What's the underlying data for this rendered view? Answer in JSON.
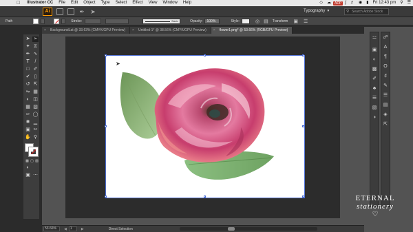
{
  "menubar": {
    "apple": "",
    "app_name": "Illustrator CC",
    "items": [
      "File",
      "Edit",
      "Object",
      "Type",
      "Select",
      "Effect",
      "View",
      "Window",
      "Help"
    ],
    "status_badge": "ADP",
    "clock": "Fri 12:43 pm"
  },
  "appbar": {
    "logo": "Ai",
    "workspace": "Typography",
    "search_placeholder": "Search Adobe Stock"
  },
  "controlbar": {
    "path_label": "Path",
    "stroke_label": "Stroke:",
    "stroke_profile": "Basic",
    "opacity_label": "Opacity:",
    "opacity_value": "100%",
    "style_label": "Style:",
    "transform_label": "Transform"
  },
  "tabs": [
    {
      "label": "BackgroundLat @ 33.63% (CMYK/GPU Preview)",
      "active": false
    },
    {
      "label": "Untitled-1* @ 38.56% (CMYK/GPU Preview)",
      "active": false
    },
    {
      "label": "flower1.png* @ 53.66% (RGB/GPU Preview)",
      "active": true
    }
  ],
  "statusbar": {
    "zoom": "53.66%",
    "page": "1",
    "tool_name": "Direct Selection"
  },
  "watermark": {
    "line1": "ETERNAL",
    "line2": "stationery",
    "heart": "♡"
  },
  "colors": {
    "artboard_outline": "#4d6fd4",
    "logo_accent": "#ff9a00",
    "rose_pink": "#d04a7a",
    "leaf_green": "#6fa660"
  },
  "icons": {
    "apple": "apple-logo-icon",
    "search": "magnifier-icon"
  }
}
